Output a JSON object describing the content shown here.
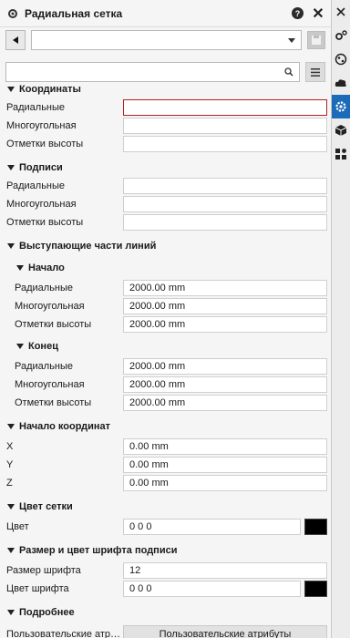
{
  "panel": {
    "title": "Радиальная сетка",
    "help_glyph": "?",
    "close_glyph": "✕"
  },
  "search": {
    "value": "",
    "placeholder": ""
  },
  "sections": {
    "coordinates": {
      "title": "Координаты",
      "rows": [
        {
          "label": "Радиальные",
          "value": ""
        },
        {
          "label": "Многоугольная",
          "value": ""
        },
        {
          "label": "Отметки высоты",
          "value": ""
        }
      ]
    },
    "labels": {
      "title": "Подписи",
      "rows": [
        {
          "label": "Радиальные",
          "value": ""
        },
        {
          "label": "Многоугольная",
          "value": ""
        },
        {
          "label": "Отметки высоты",
          "value": ""
        }
      ]
    },
    "extensions": {
      "title": "Выступающие части линий",
      "start": {
        "title": "Начало",
        "rows": [
          {
            "label": "Радиальные",
            "value": "2000.00 mm"
          },
          {
            "label": "Многоугольная",
            "value": "2000.00 mm"
          },
          {
            "label": "Отметки высоты",
            "value": "2000.00 mm"
          }
        ]
      },
      "end": {
        "title": "Конец",
        "rows": [
          {
            "label": "Радиальные",
            "value": "2000.00 mm"
          },
          {
            "label": "Многоугольная",
            "value": "2000.00 mm"
          },
          {
            "label": "Отметки высоты",
            "value": "2000.00 mm"
          }
        ]
      }
    },
    "origin": {
      "title": "Начало координат",
      "rows": [
        {
          "label": "X",
          "value": "0.00 mm"
        },
        {
          "label": "Y",
          "value": "0.00 mm"
        },
        {
          "label": "Z",
          "value": "0.00 mm"
        }
      ]
    },
    "grid_color": {
      "title": "Цвет сетки",
      "label": "Цвет",
      "value": "0 0 0",
      "swatch": "#000000"
    },
    "font": {
      "title": "Размер и цвет шрифта подписи",
      "size_label": "Размер шрифта",
      "size_value": "12",
      "color_label": "Цвет шрифта",
      "color_value": "0 0 0",
      "swatch": "#000000"
    },
    "more": {
      "title": "Подробнее",
      "label": "Пользовательские атри...",
      "button": "Пользовательские атрибуты"
    }
  },
  "colors": {
    "accent": "#1c6bb8",
    "focus_border": "#b22222"
  }
}
